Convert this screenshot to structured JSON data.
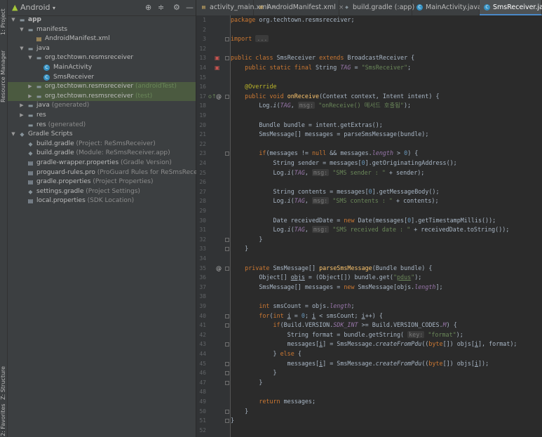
{
  "left_stripe": {
    "project_tab": "1: Project",
    "resource_tab": "Resource Manager",
    "structure_tab": "Z: Structure",
    "favorites_tab": "2: Favorites"
  },
  "project_toolbar": {
    "view_mode": "Android"
  },
  "tree": [
    {
      "label": "app",
      "sub": "",
      "indent": 0,
      "arrow": "▼",
      "icon": "folder",
      "bold": true
    },
    {
      "label": "manifests",
      "sub": "",
      "indent": 1,
      "arrow": "▼",
      "icon": "folder"
    },
    {
      "label": "AndroidManifest.xml",
      "sub": "",
      "indent": 2,
      "arrow": "",
      "icon": "xml"
    },
    {
      "label": "java",
      "sub": "",
      "indent": 1,
      "arrow": "▼",
      "icon": "folder"
    },
    {
      "label": "org.techtown.resmsreceiver",
      "sub": "",
      "indent": 2,
      "arrow": "▼",
      "icon": "folder"
    },
    {
      "label": "MainActivity",
      "sub": "",
      "indent": 3,
      "arrow": "",
      "icon": "class"
    },
    {
      "label": "SmsReceiver",
      "sub": "",
      "indent": 3,
      "arrow": "",
      "icon": "class"
    },
    {
      "label": "org.techtown.resmsreceiver",
      "sub": "(androidTest)",
      "indent": 2,
      "arrow": "▶",
      "icon": "folder",
      "selected": true
    },
    {
      "label": "org.techtown.resmsreceiver",
      "sub": "(test)",
      "indent": 2,
      "arrow": "▶",
      "icon": "folder",
      "selected": true
    },
    {
      "label": "java",
      "sub": "(generated)",
      "indent": 1,
      "arrow": "▶",
      "icon": "folder"
    },
    {
      "label": "res",
      "sub": "",
      "indent": 1,
      "arrow": "▶",
      "icon": "folder"
    },
    {
      "label": "res",
      "sub": "(generated)",
      "indent": 1,
      "arrow": "",
      "icon": "folder"
    },
    {
      "label": "Gradle Scripts",
      "sub": "",
      "indent": 0,
      "arrow": "▼",
      "icon": "gradle"
    },
    {
      "label": "build.gradle",
      "sub": "(Project: ReSmsReceiver)",
      "indent": 1,
      "arrow": "",
      "icon": "gradle"
    },
    {
      "label": "build.gradle",
      "sub": "(Module: ReSmsReceiver.app)",
      "indent": 1,
      "arrow": "",
      "icon": "gradle"
    },
    {
      "label": "gradle-wrapper.properties",
      "sub": "(Gradle Version)",
      "indent": 1,
      "arrow": "",
      "icon": "file"
    },
    {
      "label": "proguard-rules.pro",
      "sub": "(ProGuard Rules for ReSmsReceiver.app)",
      "indent": 1,
      "arrow": "",
      "icon": "file"
    },
    {
      "label": "gradle.properties",
      "sub": "(Project Properties)",
      "indent": 1,
      "arrow": "",
      "icon": "file"
    },
    {
      "label": "settings.gradle",
      "sub": "(Project Settings)",
      "indent": 1,
      "arrow": "",
      "icon": "gradle"
    },
    {
      "label": "local.properties",
      "sub": "(SDK Location)",
      "indent": 1,
      "arrow": "",
      "icon": "file"
    }
  ],
  "tabs": [
    {
      "label": "activity_main.xml",
      "icon": "xml",
      "active": false
    },
    {
      "label": "AndroidManifest.xml",
      "icon": "xml",
      "active": false
    },
    {
      "label": "build.gradle (:app)",
      "icon": "gradle",
      "active": false
    },
    {
      "label": "MainActivity.java",
      "icon": "class",
      "active": false
    },
    {
      "label": "SmsReceiver.java",
      "icon": "class",
      "active": true
    }
  ],
  "editor": {
    "line_numbers": [
      "1",
      "2",
      "3",
      "12",
      "13",
      "14",
      "15",
      "16",
      "17",
      "18",
      "19",
      "20",
      "21",
      "22",
      "23",
      "24",
      "25",
      "26",
      "27",
      "28",
      "29",
      "30",
      "31",
      "32",
      "33",
      "34",
      "35",
      "36",
      "37",
      "38",
      "39",
      "40",
      "41",
      "42",
      "43",
      "44",
      "45",
      "46",
      "47",
      "48",
      "49",
      "50",
      "51",
      "52"
    ],
    "code_lines": [
      [
        [
          "kw",
          "package "
        ],
        [
          "",
          "org.techtown.resmsreceiver;"
        ]
      ],
      [],
      [
        [
          "kw",
          "import "
        ],
        [
          "hint",
          "..."
        ]
      ],
      [],
      [
        [
          "kw",
          "public class "
        ],
        [
          "",
          "SmsReceiver "
        ],
        [
          "kw",
          "extends "
        ],
        [
          "",
          "BroadcastReceiver {"
        ]
      ],
      [
        [
          "",
          "    "
        ],
        [
          "kw",
          "public static final "
        ],
        [
          "",
          "String "
        ],
        [
          "fld",
          "TAG"
        ],
        [
          "",
          " = "
        ],
        [
          "str",
          "\"SmsReceiver\""
        ],
        [
          "",
          ";"
        ]
      ],
      [],
      [
        [
          "",
          "    "
        ],
        [
          "ann",
          "@Override"
        ]
      ],
      [
        [
          "",
          "    "
        ],
        [
          "kw",
          "public void "
        ],
        [
          "fn",
          "onReceive"
        ],
        [
          "",
          "(Context context, Intent intent) {"
        ]
      ],
      [
        [
          "",
          "        Log."
        ],
        [
          "st",
          "i"
        ],
        [
          "",
          "("
        ],
        [
          "fld",
          "TAG"
        ],
        [
          "",
          ", "
        ],
        [
          "hint",
          "msg:"
        ],
        [
          "",
          " "
        ],
        [
          "str",
          "\"onReceive() 메서드 호출됨\""
        ],
        [
          "",
          ");"
        ]
      ],
      [],
      [
        [
          "",
          "        Bundle bundle = intent.getExtras();"
        ]
      ],
      [
        [
          "",
          "        SmsMessage[] messages = parseSmsMessage(bundle);"
        ]
      ],
      [],
      [
        [
          "",
          "        "
        ],
        [
          "kw",
          "if"
        ],
        [
          "",
          "(messages != "
        ],
        [
          "kw",
          "null "
        ],
        [
          "",
          "&& messages."
        ],
        [
          "fld",
          "length"
        ],
        [
          "",
          " > "
        ],
        [
          "num",
          "0"
        ],
        [
          "",
          ") {"
        ]
      ],
      [
        [
          "",
          "            String sender = messages["
        ],
        [
          "num",
          "0"
        ],
        [
          "",
          "].getOriginatingAddress();"
        ]
      ],
      [
        [
          "",
          "            Log."
        ],
        [
          "st",
          "i"
        ],
        [
          "",
          "("
        ],
        [
          "fld",
          "TAG"
        ],
        [
          "",
          ", "
        ],
        [
          "hint",
          "msg:"
        ],
        [
          "",
          " "
        ],
        [
          "str",
          "\"SMS sender : \""
        ],
        [
          "",
          " + sender);"
        ]
      ],
      [],
      [
        [
          "",
          "            String contents = messages["
        ],
        [
          "num",
          "0"
        ],
        [
          "",
          "].getMessageBody();"
        ]
      ],
      [
        [
          "",
          "            Log."
        ],
        [
          "st",
          "i"
        ],
        [
          "",
          "("
        ],
        [
          "fld",
          "TAG"
        ],
        [
          "",
          ", "
        ],
        [
          "hint",
          "msg:"
        ],
        [
          "",
          " "
        ],
        [
          "str",
          "\"SMS contents : \""
        ],
        [
          "",
          " + contents);"
        ]
      ],
      [],
      [
        [
          "",
          "            Date receivedDate = "
        ],
        [
          "kw",
          "new "
        ],
        [
          "",
          "Date(messages["
        ],
        [
          "num",
          "0"
        ],
        [
          "",
          "].getTimestampMillis());"
        ]
      ],
      [
        [
          "",
          "            Log."
        ],
        [
          "st",
          "i"
        ],
        [
          "",
          "("
        ],
        [
          "fld",
          "TAG"
        ],
        [
          "",
          ", "
        ],
        [
          "hint",
          "msg:"
        ],
        [
          "",
          " "
        ],
        [
          "str",
          "\"SMS received date : \""
        ],
        [
          "",
          " + receivedDate.toString());"
        ]
      ],
      [
        [
          "",
          "        }"
        ]
      ],
      [
        [
          "",
          "    }"
        ]
      ],
      [],
      [
        [
          "",
          "    "
        ],
        [
          "kw",
          "private "
        ],
        [
          "",
          "SmsMessage[] "
        ],
        [
          "fn",
          "parseSmsMessage"
        ],
        [
          "",
          "(Bundle bundle) {"
        ]
      ],
      [
        [
          "",
          "        Object[] "
        ],
        [
          "ul",
          "objs"
        ],
        [
          "",
          " = (Object[]) bundle.get("
        ],
        [
          "str",
          "\""
        ],
        [
          "strul",
          "pdus"
        ],
        [
          "str",
          "\""
        ],
        [
          "",
          ");"
        ]
      ],
      [
        [
          "",
          "        SmsMessage[] messages = "
        ],
        [
          "kw",
          "new "
        ],
        [
          "",
          "SmsMessage[objs."
        ],
        [
          "fld",
          "length"
        ],
        [
          "",
          "];"
        ]
      ],
      [],
      [
        [
          "",
          "        "
        ],
        [
          "kw",
          "int "
        ],
        [
          "",
          "smsCount = objs."
        ],
        [
          "fld",
          "length"
        ],
        [
          "",
          ";"
        ]
      ],
      [
        [
          "",
          "        "
        ],
        [
          "kw",
          "for"
        ],
        [
          "",
          "("
        ],
        [
          "kw",
          "int "
        ],
        [
          "ul",
          "i"
        ],
        [
          "",
          " = "
        ],
        [
          "num",
          "0"
        ],
        [
          "",
          "; "
        ],
        [
          "ul",
          "i"
        ],
        [
          "",
          " < smsCount; "
        ],
        [
          "ul",
          "i"
        ],
        [
          "",
          "++) {"
        ]
      ],
      [
        [
          "",
          "            "
        ],
        [
          "kw",
          "if"
        ],
        [
          "",
          "(Build.VERSION."
        ],
        [
          "fld",
          "SDK_INT"
        ],
        [
          "",
          " >= Build.VERSION_CODES."
        ],
        [
          "fld",
          "M"
        ],
        [
          "",
          ") {"
        ]
      ],
      [
        [
          "",
          "                String format = bundle.getString( "
        ],
        [
          "hint",
          "key:"
        ],
        [
          "",
          " "
        ],
        [
          "str",
          "\"format\""
        ],
        [
          "",
          ");"
        ]
      ],
      [
        [
          "",
          "                messages["
        ],
        [
          "ul",
          "i"
        ],
        [
          "",
          "] = SmsMessage."
        ],
        [
          "st",
          "createFromPdu"
        ],
        [
          "",
          "(("
        ],
        [
          "kw",
          "byte"
        ],
        [
          "",
          "[]) objs["
        ],
        [
          "ul",
          "i"
        ],
        [
          "",
          "], format);"
        ]
      ],
      [
        [
          "",
          "            } "
        ],
        [
          "kw",
          "else "
        ],
        [
          "",
          "{"
        ]
      ],
      [
        [
          "",
          "                messages["
        ],
        [
          "ul",
          "i"
        ],
        [
          "",
          "] = SmsMessage."
        ],
        [
          "st",
          "createFromPdu"
        ],
        [
          "",
          "(("
        ],
        [
          "kw",
          "byte"
        ],
        [
          "",
          "[]) objs["
        ],
        [
          "ul",
          "i"
        ],
        [
          "",
          "]);"
        ]
      ],
      [
        [
          "",
          "            }"
        ]
      ],
      [
        [
          "",
          "        }"
        ]
      ],
      [],
      [
        [
          "",
          "        "
        ],
        [
          "kw",
          "return "
        ],
        [
          "",
          "messages;"
        ]
      ],
      [
        [
          "",
          "    }"
        ]
      ],
      [
        [
          "",
          "}"
        ]
      ],
      []
    ]
  },
  "colors": {
    "keyword": "#cc7832",
    "string": "#6a8759",
    "number": "#6897bb",
    "annotation": "#bbb529",
    "field": "#9876aa",
    "function": "#ffc66d",
    "text": "#a9b7c6",
    "background": "#2b2b2b",
    "panel": "#3c3f41",
    "selection": "#4b5a40"
  }
}
